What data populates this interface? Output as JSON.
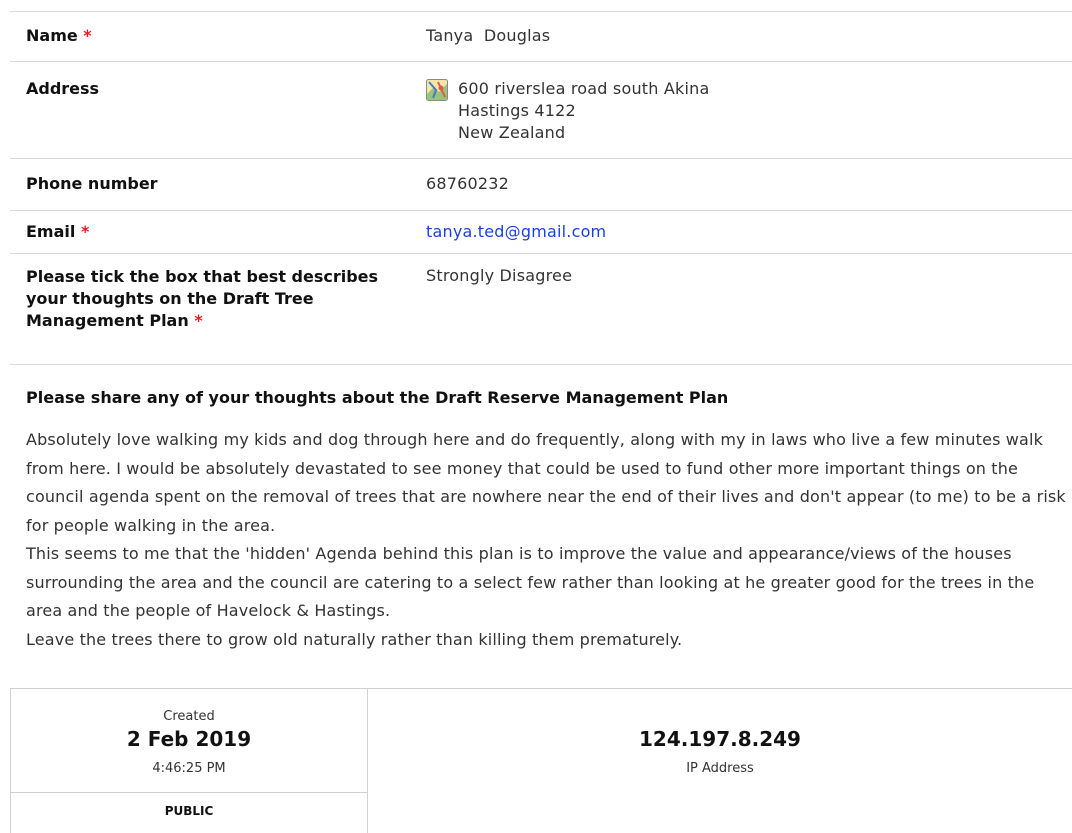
{
  "fields": {
    "name": {
      "label": "Name",
      "required": "*",
      "value": "Tanya  Douglas"
    },
    "address": {
      "label": "Address",
      "icon": "map-icon",
      "line1": "600 riverslea road south Akina",
      "line2": "Hastings 4122",
      "line3": "New Zealand"
    },
    "phone": {
      "label": "Phone number",
      "value": "68760232"
    },
    "email": {
      "label": "Email",
      "required": "*",
      "value": "tanya.ted@gmail.com"
    },
    "opinion": {
      "label": "Please tick the box that best describes your thoughts on the Draft Tree Management Plan",
      "required": "*",
      "value": "Strongly Disagree"
    }
  },
  "thoughts": {
    "heading": "Please share any of your thoughts about the Draft Reserve Management Plan",
    "paragraph1": "Absolutely love walking my kids and dog through here and do frequently, along with my in laws who live a few minutes walk from here. I would be absolutely devastated to see money that could be used to fund other more important things on the council agenda spent on the removal of trees that are nowhere near the end of their lives and don't appear (to me) to be a risk for people walking in the area.",
    "paragraph2": "This seems to me that the 'hidden' Agenda behind this plan is to improve the value and appearance/views of the houses surrounding the area and the council are catering to a select few rather than looking at he greater good for the trees in the area and the people of Havelock & Hastings.",
    "paragraph3": "Leave the trees there to grow old naturally rather than killing them prematurely."
  },
  "meta": {
    "created_label": "Created",
    "created_date": "2 Feb 2019",
    "created_time": "4:46:25 PM",
    "visibility": "PUBLIC",
    "ip_value": "124.197.8.249",
    "ip_label": "IP Address"
  },
  "colors": {
    "required": "#e02020",
    "link": "#1a3fe0",
    "divider": "#d9d9d9"
  }
}
